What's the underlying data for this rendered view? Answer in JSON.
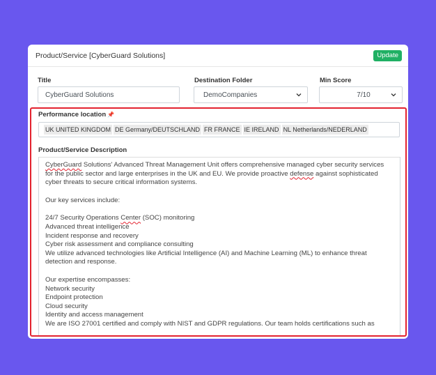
{
  "card": {
    "title": "Product/Service [CyberGuard Solutions]",
    "update_label": "Update"
  },
  "labels": {
    "title": "Title",
    "destination_folder": "Destination Folder",
    "min_score": "Min Score"
  },
  "fields": {
    "title_value": "CyberGuard Solutions",
    "destination_folder_value": "DemoCompanies",
    "min_score_value": "7/10"
  },
  "performance": {
    "label": "Performance location",
    "pin_icon": "pin-icon",
    "tags": [
      "UK UNITED KINGDOM",
      "DE Germany/DEUTSCHLAND",
      "FR FRANCE",
      "IE IRELAND",
      "NL Netherlands/NEDERLAND"
    ]
  },
  "description": {
    "label": "Product/Service Description",
    "intro_pre": "",
    "intro_word1": "CyberGuard",
    "intro_mid": " Solutions' Advanced Threat Management Unit offers comprehensive managed cyber security services for the public sector and large enterprises in the UK and EU. We provide proactive ",
    "intro_word2": "defense",
    "intro_post": " against sophisticated cyber threats to secure critical information systems.",
    "services_heading": "Our key services include:",
    "service1_pre": "24/7 Security Operations ",
    "service1_word": "Center",
    "service1_post": " (SOC) monitoring",
    "service2": "Advanced threat intelligence",
    "service3": "Incident response and recovery",
    "service4": "Cyber risk assessment and compliance consulting",
    "service5": "We utilize advanced technologies like Artificial Intelligence (AI) and Machine Learning (ML) to enhance threat detection and response.",
    "expertise_heading": "Our expertise encompasses:",
    "expertise1": "Network security",
    "expertise2": "Endpoint protection",
    "expertise3": "Cloud security",
    "expertise4": "Identity and access management",
    "truncated_line": "We are ISO 27001 certified and comply with NIST and GDPR regulations. Our team holds certifications such as"
  },
  "colors": {
    "background": "#6957ee",
    "update_button": "#20b064",
    "highlight_border": "#e3222f"
  }
}
